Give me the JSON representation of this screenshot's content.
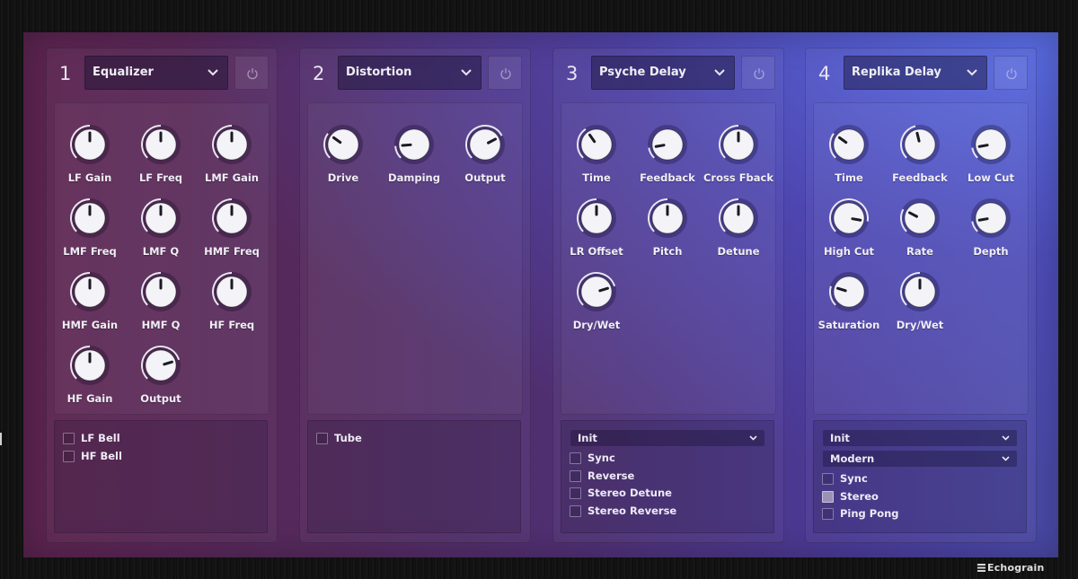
{
  "brand": {
    "name": "Echograin"
  },
  "colors": {
    "knob_face": "#f4f3f7",
    "knob_pointer": "#1a1a22",
    "arc": "#e9e6f2",
    "checkbox_checked": "#9a92b4"
  },
  "icons": {
    "power": "power-icon",
    "dropdown": "chevron-down-icon"
  },
  "modules": [
    {
      "number": "1",
      "effect": "Equalizer",
      "knobs": [
        {
          "label": "LF Gain",
          "value": 0.5
        },
        {
          "label": "LF Freq",
          "value": 0.5
        },
        {
          "label": "LMF Gain",
          "value": 0.5
        },
        {
          "label": "LMF Freq",
          "value": 0.5
        },
        {
          "label": "LMF Q",
          "value": 0.5
        },
        {
          "label": "HMF Freq",
          "value": 0.5
        },
        {
          "label": "HMF Gain",
          "value": 0.5
        },
        {
          "label": "HMF Q",
          "value": 0.5
        },
        {
          "label": "HF Freq",
          "value": 0.5
        },
        {
          "label": "HF Gain",
          "value": 0.5
        },
        {
          "label": "Output",
          "value": 0.77
        }
      ],
      "selects": [],
      "checkboxes": [
        {
          "label": "LF Bell",
          "checked": false
        },
        {
          "label": "HF Bell",
          "checked": false
        }
      ]
    },
    {
      "number": "2",
      "effect": "Distortion",
      "knobs": [
        {
          "label": "Drive",
          "value": 0.3
        },
        {
          "label": "Damping",
          "value": 0.15
        },
        {
          "label": "Output",
          "value": 0.73
        }
      ],
      "selects": [],
      "checkboxes": [
        {
          "label": "Tube",
          "checked": false
        }
      ]
    },
    {
      "number": "3",
      "effect": "Psyche Delay",
      "knobs": [
        {
          "label": "Time",
          "value": 0.37
        },
        {
          "label": "Feedback",
          "value": 0.13
        },
        {
          "label": "Cross Fback",
          "value": 0.5
        },
        {
          "label": "LR Offset",
          "value": 0.5
        },
        {
          "label": "Pitch",
          "value": 0.5
        },
        {
          "label": "Detune",
          "value": 0.5
        },
        {
          "label": "Dry/Wet",
          "value": 0.77
        }
      ],
      "selects": [
        {
          "value": "Init"
        }
      ],
      "checkboxes": [
        {
          "label": "Sync",
          "checked": false
        },
        {
          "label": "Reverse",
          "checked": false
        },
        {
          "label": "Stereo Detune",
          "checked": false
        },
        {
          "label": "Stereo Reverse",
          "checked": false
        }
      ]
    },
    {
      "number": "4",
      "effect": "Replika Delay",
      "knobs": [
        {
          "label": "Time",
          "value": 0.3
        },
        {
          "label": "Feedback",
          "value": 0.45
        },
        {
          "label": "Low Cut",
          "value": 0.13
        },
        {
          "label": "High Cut",
          "value": 0.87
        },
        {
          "label": "Rate",
          "value": 0.27
        },
        {
          "label": "Depth",
          "value": 0.13
        },
        {
          "label": "Saturation",
          "value": 0.23
        },
        {
          "label": "Dry/Wet",
          "value": 0.5
        }
      ],
      "selects": [
        {
          "value": "Init"
        },
        {
          "value": "Modern"
        }
      ],
      "checkboxes": [
        {
          "label": "Sync",
          "checked": false
        },
        {
          "label": "Stereo",
          "checked": true
        },
        {
          "label": "Ping Pong",
          "checked": false
        }
      ]
    }
  ]
}
